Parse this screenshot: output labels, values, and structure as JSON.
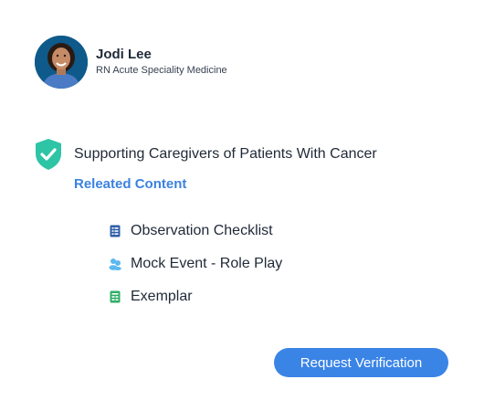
{
  "profile": {
    "name": "Jodi Lee",
    "role": "RN Acute Speciality Medicine"
  },
  "course": {
    "title": "Supporting Caregivers of Patients With Cancer",
    "status_icon": "shield-check-icon",
    "status_color": "#2ec4a6"
  },
  "related": {
    "heading": "Releated Content",
    "items": [
      {
        "label": "Observation Checklist",
        "icon": "checklist-icon",
        "color": "#2f5fa8"
      },
      {
        "label": "Mock Event - Role Play",
        "icon": "people-icon",
        "color": "#5bb8f0"
      },
      {
        "label": "Exemplar",
        "icon": "exemplar-icon",
        "color": "#2fae66"
      }
    ]
  },
  "actions": {
    "request_label": "Request Verification",
    "accent": "#3a84e6"
  }
}
